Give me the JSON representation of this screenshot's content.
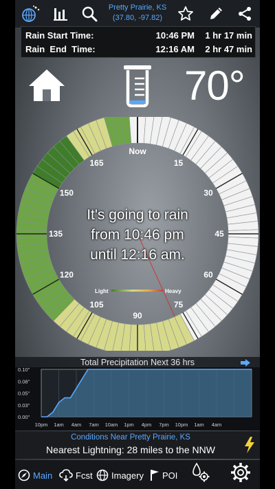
{
  "header": {
    "location_name": "Pretty Prairie, KS",
    "location_coords": "(37.80, -97.82)"
  },
  "rain_times": {
    "rows": [
      {
        "label": "Rain Start Time:",
        "time": "10:46 PM",
        "duration": "1 hr 17 min"
      },
      {
        "label": "Rain  End  Time:",
        "time": "12:16 AM",
        "duration": "2 hr 47 min"
      }
    ]
  },
  "temperature": "70°",
  "dial": {
    "now_label": "Now",
    "minute_labels": [
      "15",
      "30",
      "45",
      "60",
      "75",
      "90",
      "105",
      "120",
      "135",
      "150",
      "165"
    ],
    "legend_light": "Light",
    "legend_heavy": "Heavy",
    "message_lines": [
      "It's going to rain",
      "from 10:46 pm",
      "until 12:16 am."
    ],
    "colors": {
      "dry": "#f2f2f2",
      "light": "#d6d98a",
      "moderate": "#6ea547",
      "heavy": "#3f7d2a"
    }
  },
  "precip_chart": {
    "title": "Total Precipitation Next 36 hrs",
    "y_ticks": [
      "0.10\"",
      "0.08\"",
      "0.05\"",
      "0.03\"",
      "0.00\""
    ],
    "x_ticks": [
      "10pm",
      "1am",
      "4am",
      "7am",
      "10am",
      "1pm",
      "4pm",
      "7pm",
      "10pm",
      "1am",
      "4am"
    ],
    "color": "#5aa8ff"
  },
  "chart_data": {
    "type": "area",
    "x": [
      0,
      1,
      2,
      3,
      4,
      5,
      6,
      7,
      8,
      9,
      10,
      11,
      12,
      18,
      24,
      30,
      36
    ],
    "values": [
      0.0,
      0.0,
      0.01,
      0.03,
      0.04,
      0.04,
      0.06,
      0.08,
      0.1,
      0.1,
      0.1,
      0.1,
      0.1,
      0.1,
      0.1,
      0.1,
      0.1
    ],
    "ylim": [
      0,
      0.1
    ],
    "xlim": [
      0,
      36
    ]
  },
  "conditions": {
    "title": "Conditions Near Pretty Prairie, KS",
    "lightning": "Nearest Lightning: 28 miles to the NNW"
  },
  "nav": {
    "main": "Main",
    "forecast": "Fcst",
    "imagery": "Imagery",
    "poi": "POI"
  }
}
